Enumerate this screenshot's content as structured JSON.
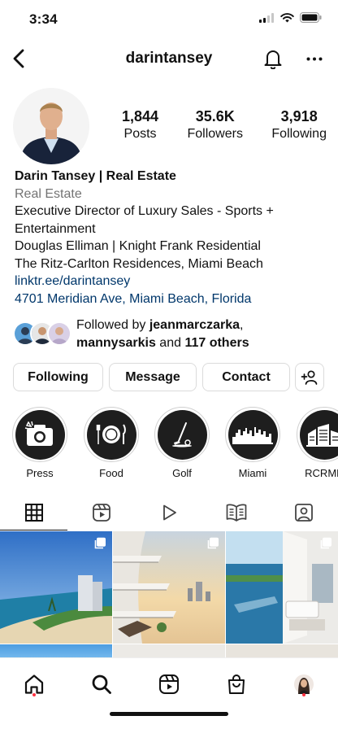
{
  "status_bar": {
    "time": "3:34"
  },
  "header": {
    "username": "darintansey"
  },
  "profile": {
    "stats": [
      {
        "value": "1,844",
        "label": "Posts"
      },
      {
        "value": "35.6K",
        "label": "Followers"
      },
      {
        "value": "3,918",
        "label": "Following"
      }
    ],
    "name": "Darin Tansey | Real Estate",
    "category": "Real Estate",
    "bio_lines": [
      "Executive Director of Luxury Sales - Sports +",
      "Entertainment",
      "Douglas Elliman | Knight Frank Residential",
      "The Ritz-Carlton Residences, Miami Beach"
    ],
    "link": "linktr.ee/darintansey",
    "address": "4701 Meridian Ave, Miami Beach, Florida"
  },
  "followed_by": {
    "prefix": "Followed by ",
    "user1": "jeanmarczarka",
    "comma": ",",
    "user2": "mannysarkis",
    "middle": " and ",
    "others": "117 others"
  },
  "actions": {
    "following_label": "Following",
    "message_label": "Message",
    "contact_label": "Contact",
    "add_person_icon": "add-person-icon"
  },
  "highlights": [
    {
      "label": "Press",
      "icon": "camera-icon"
    },
    {
      "label": "Food",
      "icon": "plate-icon"
    },
    {
      "label": "Golf",
      "icon": "golf-icon"
    },
    {
      "label": "Miami",
      "icon": "skyline-icon"
    },
    {
      "label": "RCRMB",
      "icon": "buildings-icon"
    }
  ],
  "tabs": [
    {
      "name": "grid",
      "icon": "grid-icon",
      "active": true
    },
    {
      "name": "reels",
      "icon": "reels-icon",
      "active": false
    },
    {
      "name": "video",
      "icon": "play-icon",
      "active": false
    },
    {
      "name": "guides",
      "icon": "guide-icon",
      "active": false
    },
    {
      "name": "tagged",
      "icon": "tagged-icon",
      "active": false
    }
  ],
  "nav": [
    {
      "name": "home",
      "icon": "home-icon",
      "dot": true
    },
    {
      "name": "search",
      "icon": "search-icon",
      "dot": false
    },
    {
      "name": "reels",
      "icon": "reels-icon",
      "dot": false
    },
    {
      "name": "shop",
      "icon": "shop-icon",
      "dot": false
    },
    {
      "name": "profile",
      "icon": "profile-avatar",
      "dot": true
    }
  ],
  "colors": {
    "link": "#00376b",
    "category": "#737373",
    "notification_dot": "#ff3040",
    "border": "#dbdbdb"
  }
}
